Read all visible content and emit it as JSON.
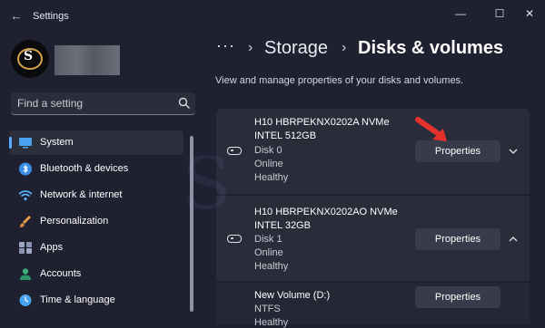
{
  "window": {
    "title": "Settings",
    "back_icon": "arrow-left-icon",
    "minimize_icon": "minimize-icon",
    "maximize_icon": "maximize-icon",
    "close_icon": "close-icon"
  },
  "search": {
    "placeholder": "Find a setting",
    "icon": "search-icon"
  },
  "sidebar": {
    "items": [
      {
        "label": "System",
        "icon": "monitor-icon",
        "active": true,
        "icon_color": "#4aa3f0"
      },
      {
        "label": "Bluetooth & devices",
        "icon": "bluetooth-icon",
        "active": false,
        "icon_color": "#3a8ee6"
      },
      {
        "label": "Network & internet",
        "icon": "wifi-icon",
        "active": false,
        "icon_color": "#5ab0f5"
      },
      {
        "label": "Personalization",
        "icon": "brush-icon",
        "active": false,
        "icon_color": "#e8a04c"
      },
      {
        "label": "Apps",
        "icon": "apps-icon",
        "active": false,
        "icon_color": "#a0a7c2"
      },
      {
        "label": "Accounts",
        "icon": "person-icon",
        "active": false,
        "icon_color": "#3ab07a"
      },
      {
        "label": "Time & language",
        "icon": "globe-clock-icon",
        "active": false,
        "icon_color": "#4aa3f0"
      }
    ]
  },
  "breadcrumb": {
    "dots": "···",
    "parent": "Storage",
    "separator": "›",
    "current": "Disks & volumes"
  },
  "description": "View and manage properties of your disks and volumes.",
  "disks": [
    {
      "name": "H10 HBRPEKNX0202A NVMe",
      "subname": "INTEL 512GB",
      "disk": "Disk 0",
      "status": "Online",
      "health": "Healthy",
      "button": "Properties",
      "chevron": "chevron-down-icon"
    },
    {
      "name": "H10 HBRPEKNX0202AO NVMe",
      "subname": "INTEL 32GB",
      "disk": "Disk 1",
      "status": "Online",
      "health": "Healthy",
      "button": "Properties",
      "chevron": "chevron-up-icon"
    }
  ],
  "volumes": [
    {
      "name": "New Volume (D:)",
      "fs": "NTFS",
      "health": "Healthy",
      "button": "Properties"
    }
  ],
  "colors": {
    "background": "#1f2030",
    "card": "#2a2c3a",
    "button": "#393b4a",
    "accent": "#5aa9ff",
    "arrow": "#e5312b"
  }
}
